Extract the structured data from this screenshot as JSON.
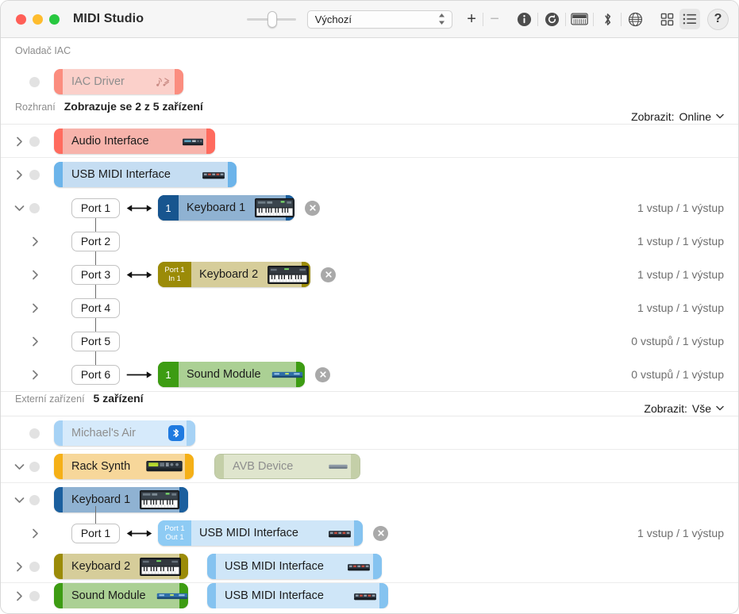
{
  "window": {
    "title": "MIDI Studio"
  },
  "toolbar": {
    "configuration_value": "Výchozí",
    "add_label": "+",
    "remove_label": "−",
    "help_label": "?",
    "icons": [
      "info-icon",
      "rescan-icon",
      "midi-keyboard-icon",
      "bluetooth-icon",
      "network-globe-icon",
      "grid-view-icon",
      "list-view-icon",
      "help-icon"
    ]
  },
  "sections": {
    "iac": {
      "label": "Ovladač IAC",
      "device": {
        "name": "IAC Driver",
        "icon": "iac-midi-icon"
      }
    },
    "interfaces": {
      "label": "Rozhraní",
      "summary": "Zobrazuje se 2 z 5 zařízení",
      "filter_label": "Zobrazit:",
      "filter_value": "Online",
      "devices": [
        {
          "name": "Audio Interface",
          "icon": "audio-interface-icon"
        },
        {
          "name": "USB MIDI Interface",
          "icon": "usb-midi-interface-icon"
        }
      ],
      "ports": [
        {
          "port": "Port 1",
          "arrow": "both",
          "device": {
            "name": "Keyboard 1",
            "badge": "1",
            "icon": "keyboard-icon"
          },
          "status": "1 vstup / 1 výstup"
        },
        {
          "port": "Port 2",
          "arrow": "none",
          "device": null,
          "status": "1 vstup / 1 výstup"
        },
        {
          "port": "Port 3",
          "arrow": "both",
          "device": {
            "name": "Keyboard 2",
            "badge": "Port 1\nIn 1",
            "badge_l1": "Port 1",
            "badge_l2": "In 1",
            "icon": "keyboard-icon"
          },
          "status": "1 vstup / 1 výstup"
        },
        {
          "port": "Port 4",
          "arrow": "none",
          "device": null,
          "status": "1 vstup / 1 výstup"
        },
        {
          "port": "Port 5",
          "arrow": "none",
          "device": null,
          "status": "0 vstupů / 1 výstup"
        },
        {
          "port": "Port 6",
          "arrow": "right",
          "device": {
            "name": "Sound Module",
            "badge": "1",
            "icon": "sound-module-icon"
          },
          "status": "0 vstupů / 1 výstup"
        }
      ]
    },
    "external": {
      "label": "Externí zařízení",
      "summary": "5 zařízení",
      "filter_label": "Zobrazit:",
      "filter_value": "Vše",
      "rows": [
        {
          "devices": [
            {
              "name": "Michael's Air",
              "icon": "bluetooth-badge-icon"
            }
          ]
        },
        {
          "devices": [
            {
              "name": "Rack Synth",
              "icon": "rack-synth-icon"
            },
            {
              "name": "AVB Device",
              "icon": "avb-device-icon"
            }
          ]
        },
        {
          "devices": [
            {
              "name": "Keyboard 1",
              "icon": "keyboard-icon"
            }
          ]
        }
      ],
      "keyboard1_port": {
        "port": "Port 1",
        "arrow": "both",
        "device": {
          "name": "USB MIDI Interface",
          "badge_l1": "Port 1",
          "badge_l2": "Out 1",
          "icon": "usb-midi-interface-icon"
        },
        "status": "1 vstup / 1 výstup"
      },
      "keyboard2_row": {
        "devices": [
          {
            "name": "Keyboard 2",
            "icon": "keyboard-icon"
          },
          {
            "name": "USB MIDI Interface",
            "icon": "usb-midi-interface-icon"
          }
        ]
      },
      "clipped_row": {
        "devices": [
          {
            "name": "Sound Module",
            "icon": "sound-module-icon"
          },
          {
            "name": "USB MIDI Interface",
            "icon": "usb-midi-interface-icon"
          }
        ]
      }
    }
  },
  "colors": {
    "red": "#ff6b5e",
    "blue": "#6cb4ea",
    "dark_blue": "#17558f",
    "olive": "#9b8b08",
    "green": "#3d9c13",
    "orange": "#f5b017",
    "sage": "#c4cfa8"
  }
}
